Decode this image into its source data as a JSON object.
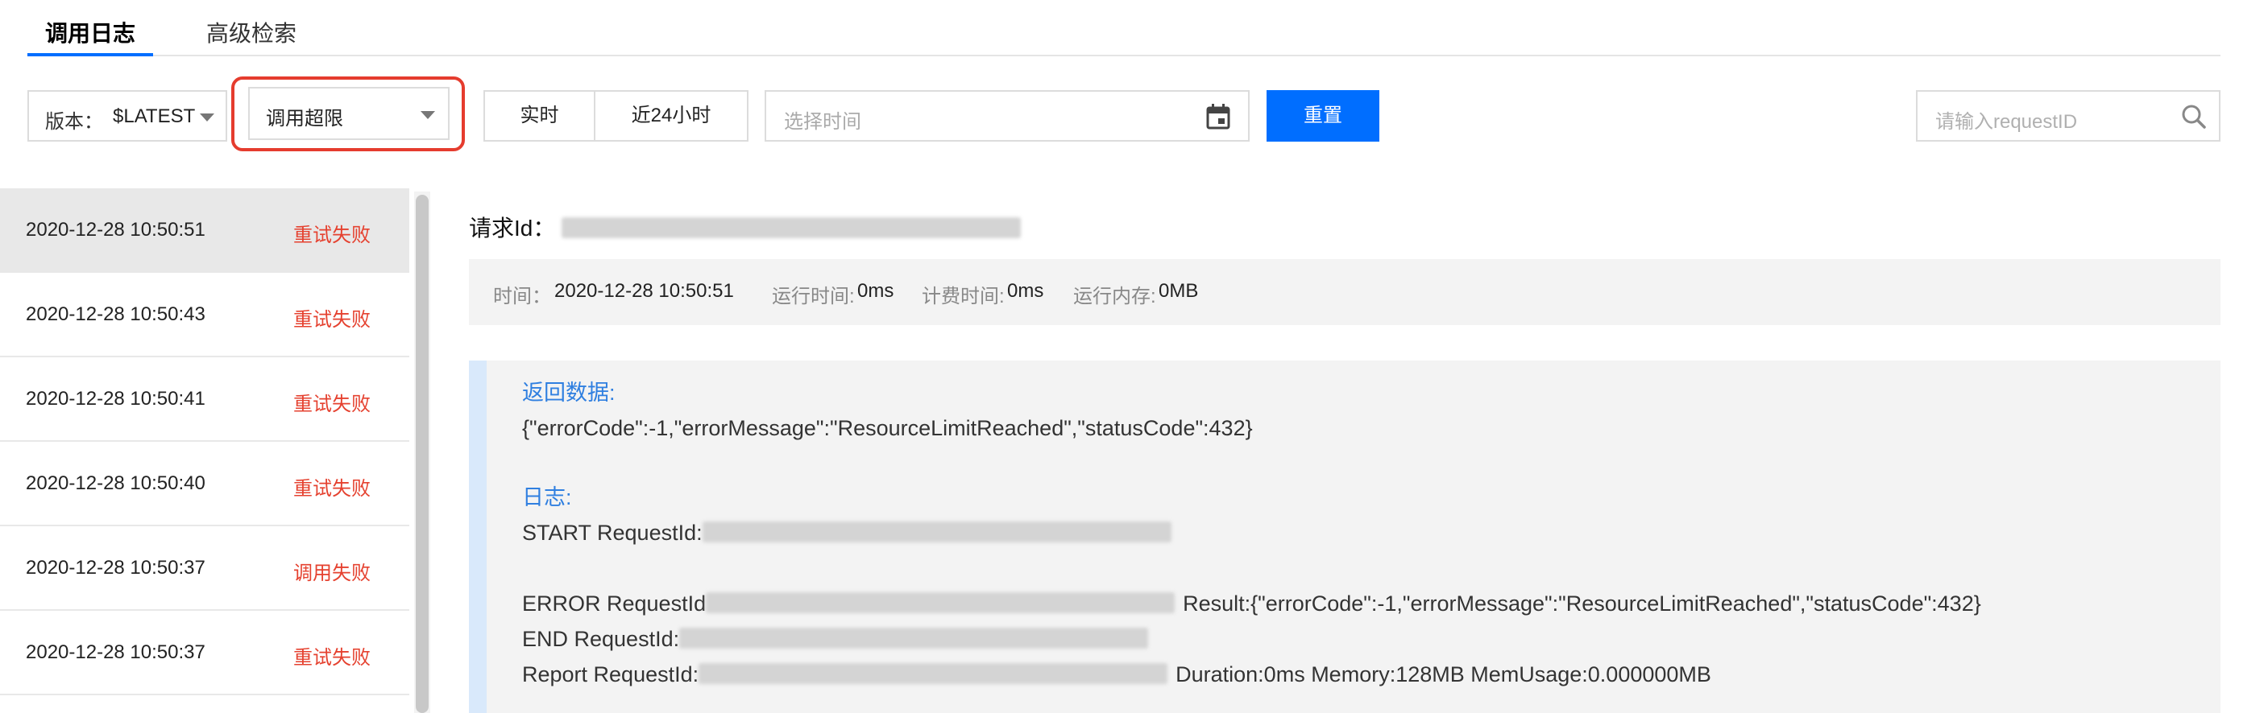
{
  "tabs": {
    "active": "调用日志",
    "inactive": "高级检索"
  },
  "toolbar": {
    "version_label": "版本：",
    "version_value": "$LATEST",
    "type_value": "调用超限",
    "realtime": "实时",
    "last24": "近24小时",
    "time_placeholder": "选择时间",
    "reset": "重置",
    "search_placeholder": "请输入requestID"
  },
  "list": [
    {
      "time": "2020-12-28 10:50:51",
      "status": "重试失败"
    },
    {
      "time": "2020-12-28 10:50:43",
      "status": "重试失败"
    },
    {
      "time": "2020-12-28 10:50:41",
      "status": "重试失败"
    },
    {
      "time": "2020-12-28 10:50:40",
      "status": "重试失败"
    },
    {
      "time": "2020-12-28 10:50:37",
      "status": "调用失败"
    },
    {
      "time": "2020-12-28 10:50:37",
      "status": "重试失败"
    }
  ],
  "detail": {
    "request_label": "请求Id：",
    "meta": {
      "time_label": "时间：",
      "time_value": "2020-12-28 10:50:51",
      "run_label": "运行时间:",
      "run_value": "0ms",
      "bill_label": "计费时间:",
      "bill_value": "0ms",
      "mem_label": "运行内存:",
      "mem_value": "0MB"
    },
    "return_head": "返回数据:",
    "return_body": "{\"errorCode\":-1,\"errorMessage\":\"ResourceLimitReached\",\"statusCode\":432}",
    "log_head": "日志:",
    "start_prefix": "START RequestId:",
    "error_prefix": "ERROR RequestId",
    "error_suffix": "Result:{\"errorCode\":-1,\"errorMessage\":\"ResourceLimitReached\",\"statusCode\":432}",
    "end_prefix": "END RequestId:",
    "report_prefix": "Report RequestId:",
    "report_suffix": "Duration:0ms Memory:128MB MemUsage:0.000000MB"
  },
  "colors": {
    "accent": "#006eff",
    "error": "#e5412f",
    "highlight": "#e53c2e"
  }
}
